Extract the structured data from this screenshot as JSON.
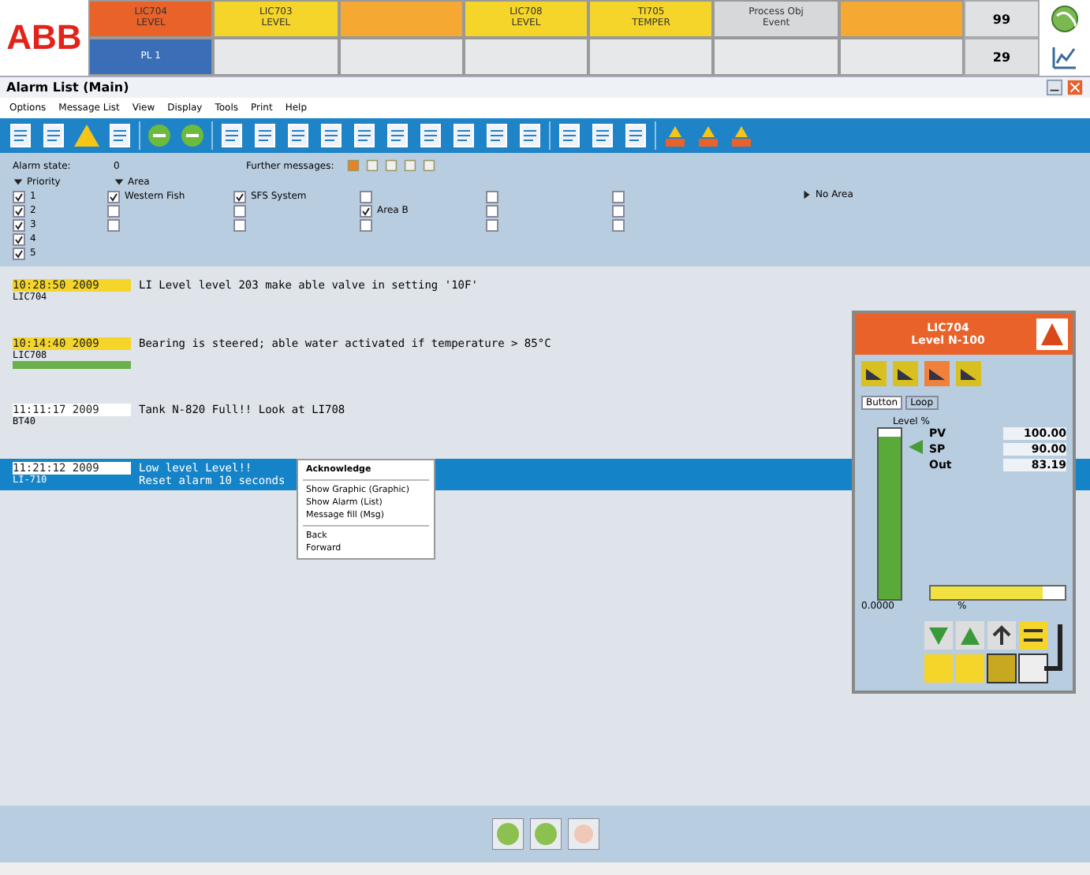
{
  "logo": "ABB",
  "alarm_tiles": [
    {
      "tag": "LIC704",
      "desc": "LEVEL",
      "color": "#e8622a"
    },
    {
      "tag": "LIC703",
      "desc": "LEVEL",
      "color": "#f5d52a"
    },
    {
      "color": "#f5a832"
    },
    {
      "tag": "LIC708",
      "desc": "LEVEL",
      "color": "#f5d52a"
    },
    {
      "tag": "TI705",
      "desc": "TEMPER",
      "color": "#f5d52a"
    },
    {
      "tag": "Process Obj",
      "desc": "Event",
      "color": "#d6d8da"
    },
    {
      "color": "#f5a832"
    }
  ],
  "second_row": [
    {
      "tag": "PL 1",
      "color": "#3a6fb8"
    }
  ],
  "counters": [
    "99",
    "29"
  ],
  "window": {
    "title": "Alarm List (Main)"
  },
  "menu": [
    "Options",
    "Message List",
    "View",
    "Display",
    "Tools",
    "Print",
    "Help"
  ],
  "filter": {
    "state_label": "Alarm state:",
    "state_value": "0",
    "further_label": "Further messages:"
  },
  "priority": {
    "label": "Priority",
    "expanded": true,
    "levels": [
      {
        "label": "1",
        "checked": true
      },
      {
        "label": "2",
        "checked": true
      },
      {
        "label": "3",
        "checked": true
      },
      {
        "label": "4",
        "checked": true
      },
      {
        "label": "5",
        "checked": true
      }
    ]
  },
  "area": {
    "label": "Area",
    "expanded": true,
    "columns": [
      [
        {
          "label": "Western Fish",
          "checked": true
        },
        {
          "checked": false
        },
        {
          "checked": false
        }
      ],
      [
        {
          "label": "SFS System",
          "checked": true
        },
        {
          "checked": false
        },
        {
          "checked": false
        }
      ],
      [
        {
          "checked": false
        },
        {
          "label": "Area B",
          "checked": true
        },
        {
          "checked": false
        }
      ],
      [
        {
          "checked": false
        },
        {
          "checked": false
        },
        {
          "checked": false
        }
      ],
      [
        {
          "checked": false
        },
        {
          "checked": false
        },
        {
          "checked": false
        }
      ]
    ],
    "no_area": "No Area"
  },
  "alarms": [
    {
      "time": "10:28:50 2009",
      "tag": "LIC704",
      "text": [
        "LI Level level 203 make able valve in setting '10F'"
      ],
      "color": "#f5d52a",
      "unacked": false,
      "selected": false
    },
    {
      "time": "10:14:40 2009",
      "tag": "LIC708",
      "text": [
        "Bearing is steered; able water activated if temperature > 85°C"
      ],
      "color": "#f5d52a",
      "unacked": true,
      "selected": false
    },
    {
      "time": "11:11:17 2009",
      "tag": "BT40",
      "text": [
        "Tank N-820 Full!! Look at LI708"
      ],
      "color": "#ffffff",
      "unacked": false,
      "selected": false
    },
    {
      "time": "11:21:12 2009",
      "tag": "LI-710",
      "text": [
        "Low level Level!!",
        "Reset alarm 10 seconds"
      ],
      "color": "#ffffff",
      "unacked": false,
      "selected": true
    }
  ],
  "context_menu": [
    [
      "Acknowledge"
    ],
    [
      "Show Graphic (Graphic)",
      "Show Alarm (List)",
      "Message fill (Msg)"
    ],
    [
      "Back",
      "Forward"
    ]
  ],
  "faceplate": {
    "tag": "LIC704",
    "desc": "Level N-100",
    "tabs": [
      {
        "label": "Button",
        "selected": true
      },
      {
        "label": "Loop",
        "selected": false
      }
    ],
    "unit_label": "Level %",
    "level": 0.95,
    "low_label": "0.0000",
    "unit": "%",
    "values": [
      {
        "name": "PV",
        "value": "100.00"
      },
      {
        "name": "SP",
        "value": "90.00"
      },
      {
        "name": "Out",
        "value": "83.19"
      }
    ],
    "output": {
      "level": 0.83
    }
  }
}
